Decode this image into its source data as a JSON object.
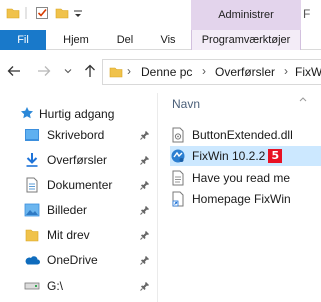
{
  "window": {
    "context_group_label": "Administrer",
    "title_fragment": "F"
  },
  "ribbon": {
    "tabs": [
      {
        "label": "Fil",
        "active": true
      },
      {
        "label": "Hjem"
      },
      {
        "label": "Del"
      },
      {
        "label": "Vis"
      },
      {
        "label": "Programværktøjer"
      }
    ]
  },
  "address_bar": {
    "crumbs": [
      "Denne pc",
      "Overførsler",
      "FixWin"
    ]
  },
  "navigation": {
    "quick_access_label": "Hurtig adgang",
    "items": [
      {
        "label": "Skrivebord",
        "icon": "desktop-icon",
        "pinned": true
      },
      {
        "label": "Overførsler",
        "icon": "downloads-icon",
        "pinned": true
      },
      {
        "label": "Dokumenter",
        "icon": "documents-icon",
        "pinned": true
      },
      {
        "label": "Billeder",
        "icon": "pictures-icon",
        "pinned": true
      },
      {
        "label": "Mit drev",
        "icon": "folder-icon",
        "pinned": true
      },
      {
        "label": "OneDrive",
        "icon": "onedrive-icon",
        "pinned": true
      },
      {
        "label": "G:\\",
        "icon": "drive-icon",
        "pinned": true
      }
    ]
  },
  "file_list": {
    "column_header": "Navn",
    "files": [
      {
        "name": "ButtonExtended.dll",
        "icon": "dll-file-icon"
      },
      {
        "name": "FixWin 10.2.2",
        "icon": "fixwin-app-icon",
        "selected": true,
        "badge": "5"
      },
      {
        "name": "Have you read me",
        "icon": "text-file-icon"
      },
      {
        "name": "Homepage FixWin",
        "icon": "shortcut-icon"
      }
    ]
  },
  "colors": {
    "accent": "#1979ca",
    "context_tab": "#e3d4ec",
    "selection": "#cce8ff",
    "badge": "#e81123"
  }
}
